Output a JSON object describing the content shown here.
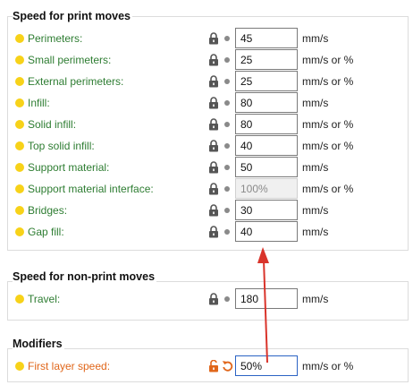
{
  "sections": {
    "print": {
      "title": "Speed for print moves",
      "rows": [
        {
          "label": "Perimeters:",
          "value": "45",
          "unit": "mm/s"
        },
        {
          "label": "Small perimeters:",
          "value": "25",
          "unit": "mm/s or %"
        },
        {
          "label": "External perimeters:",
          "value": "25",
          "unit": "mm/s or %"
        },
        {
          "label": "Infill:",
          "value": "80",
          "unit": "mm/s"
        },
        {
          "label": "Solid infill:",
          "value": "80",
          "unit": "mm/s or %"
        },
        {
          "label": "Top solid infill:",
          "value": "40",
          "unit": "mm/s or %"
        },
        {
          "label": "Support material:",
          "value": "50",
          "unit": "mm/s"
        },
        {
          "label": "Support material interface:",
          "value": "100%",
          "unit": "mm/s or %"
        },
        {
          "label": "Bridges:",
          "value": "30",
          "unit": "mm/s"
        },
        {
          "label": "Gap fill:",
          "value": "40",
          "unit": "mm/s"
        }
      ]
    },
    "nonprint": {
      "title": "Speed for non-print moves",
      "rows": [
        {
          "label": "Travel:",
          "value": "180",
          "unit": "mm/s"
        }
      ]
    },
    "modifiers": {
      "title": "Modifiers",
      "rows": [
        {
          "label": "First layer speed:",
          "value": "50%",
          "unit": "mm/s or %"
        }
      ]
    }
  },
  "colors": {
    "label_default": "#2e7d32",
    "label_modified": "#e0661a",
    "status_dot": "#f7d219",
    "annotation_arrow": "#d9342b"
  },
  "icons": {
    "system_value": "lock-icon",
    "modified_value": "unlock-icon",
    "reset": "undo-arrow-icon"
  }
}
